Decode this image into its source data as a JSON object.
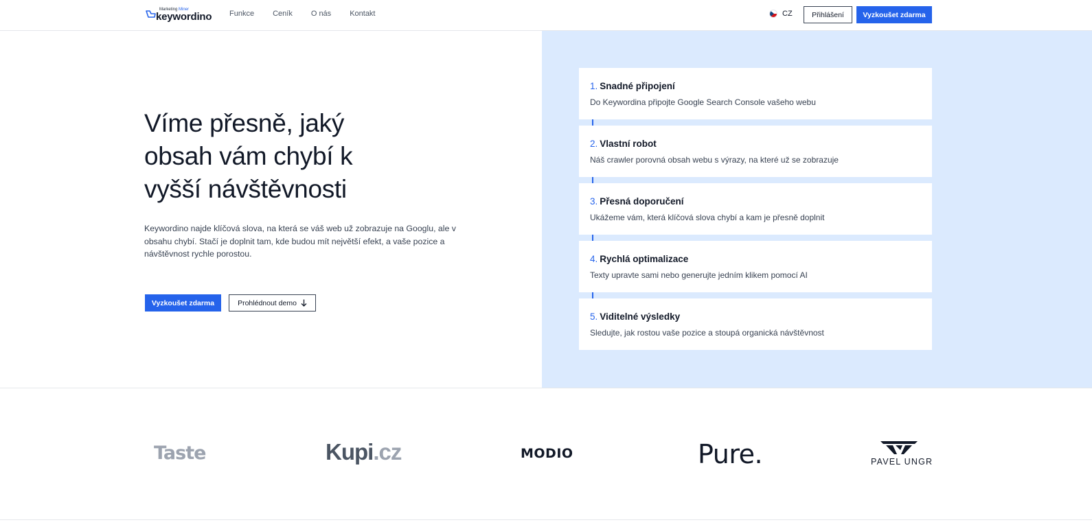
{
  "header": {
    "logo_sub_prefix": "Marketing",
    "logo_sub_accent": "Miner",
    "logo_main": "keywordino",
    "nav": [
      "Funkce",
      "Ceník",
      "O nás",
      "Kontakt"
    ],
    "language": "CZ",
    "login_label": "Přihlášení",
    "try_label": "Vyzkoušet zdarma"
  },
  "hero": {
    "title_lines": [
      "Víme přesně, jaký",
      "obsah vám chybí k",
      "vyšší návštěvnosti"
    ],
    "description": "Keywordino najde klíčová slova, na která se váš web už zobrazuje na Googlu, ale v obsahu chybí. Stačí je doplnit tam, kde budou mít největší efekt, a vaše pozice a návštěvnost rychle porostou.",
    "primary_cta": "Vyzkoušet zdarma",
    "secondary_cta": "Prohlédnout demo"
  },
  "steps": [
    {
      "num": "1.",
      "title": "Snadné připojení",
      "desc": "Do Keywordina připojte Google Search Console vašeho webu"
    },
    {
      "num": "2.",
      "title": "Vlastní robot",
      "desc": "Náš crawler porovná obsah webu s výrazy, na které už se zobrazuje"
    },
    {
      "num": "3.",
      "title": "Přesná doporučení",
      "desc": "Ukážeme vám, která klíčová slova chybí a kam je přesně doplnit"
    },
    {
      "num": "4.",
      "title": "Rychlá optimalizace",
      "desc": "Texty upravte sami nebo generujte jedním klikem pomocí AI"
    },
    {
      "num": "5.",
      "title": "Viditelné výsledky",
      "desc": "Sledujte, jak rostou vaše pozice a stoupá organická návštěvnost"
    }
  ],
  "clients": {
    "taste": "Taste",
    "kupi_main": "Kupi",
    "kupi_suffix": ".cz",
    "modio": "MODIO",
    "pure": "Pure.",
    "pavel": "PAVEL UNGR"
  },
  "colors": {
    "accent": "#2563eb",
    "panel": "#dbeafe"
  }
}
